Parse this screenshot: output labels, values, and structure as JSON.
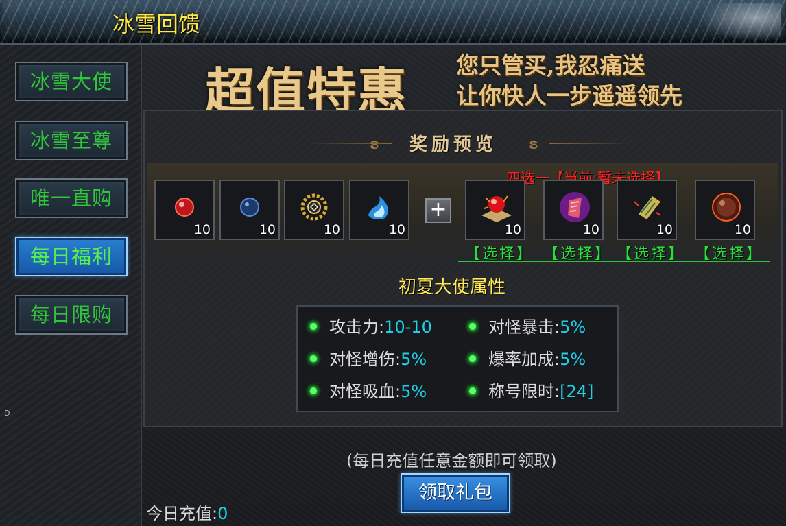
{
  "window": {
    "title": "冰雪回馈"
  },
  "sidebar": {
    "items": [
      {
        "label": "冰雪大使",
        "active": false
      },
      {
        "label": "冰雪至尊",
        "active": false
      },
      {
        "label": "唯一直购",
        "active": false
      },
      {
        "label": "每日福利",
        "active": true
      },
      {
        "label": "每日限购",
        "active": false
      }
    ],
    "marker": "D"
  },
  "banner": {
    "big": "超值特惠",
    "line1": "您只管买,我忍痛送",
    "line2": "让你快人一步遥遥领先"
  },
  "rewards": {
    "title": "奖励预览",
    "fixed_items": [
      {
        "icon": "red-orb-icon",
        "count": "10"
      },
      {
        "icon": "blue-orb-icon",
        "count": "10"
      },
      {
        "icon": "golden-emblem-icon",
        "count": "10"
      },
      {
        "icon": "blue-flame-icon",
        "count": "10"
      }
    ],
    "choice_note": "四选一【当前:暂未选择】",
    "choice_items": [
      {
        "icon": "fire-orb-book-icon",
        "count": "10",
        "select_label": "【选择】"
      },
      {
        "icon": "purple-scroll-icon",
        "count": "10",
        "select_label": "【选择】"
      },
      {
        "icon": "gold-scroll-icon",
        "count": "10",
        "select_label": "【选择】"
      },
      {
        "icon": "dark-orb-icon",
        "count": "10",
        "select_label": "【选择】"
      }
    ]
  },
  "attributes": {
    "title": "初夏大使属性",
    "stats": [
      {
        "label": "攻击力:",
        "value": "10-10"
      },
      {
        "label": "对怪暴击:",
        "value": "5%"
      },
      {
        "label": "对怪增伤:",
        "value": "5%"
      },
      {
        "label": "爆率加成:",
        "value": "5%"
      },
      {
        "label": "对怪吸血:",
        "value": "5%"
      },
      {
        "label": "称号限时:",
        "value": "[24]"
      }
    ]
  },
  "footer": {
    "note": "(每日充值任意金额即可领取)",
    "claim_label": "领取礼包",
    "recharge_label": "今日充值:",
    "recharge_value": "0"
  },
  "colors": {
    "title": "#ffe84a",
    "sidebar_text": "#31c53b",
    "value": "#1ecfe8",
    "choose_note": "#ff2020",
    "select": "#29e03b"
  }
}
